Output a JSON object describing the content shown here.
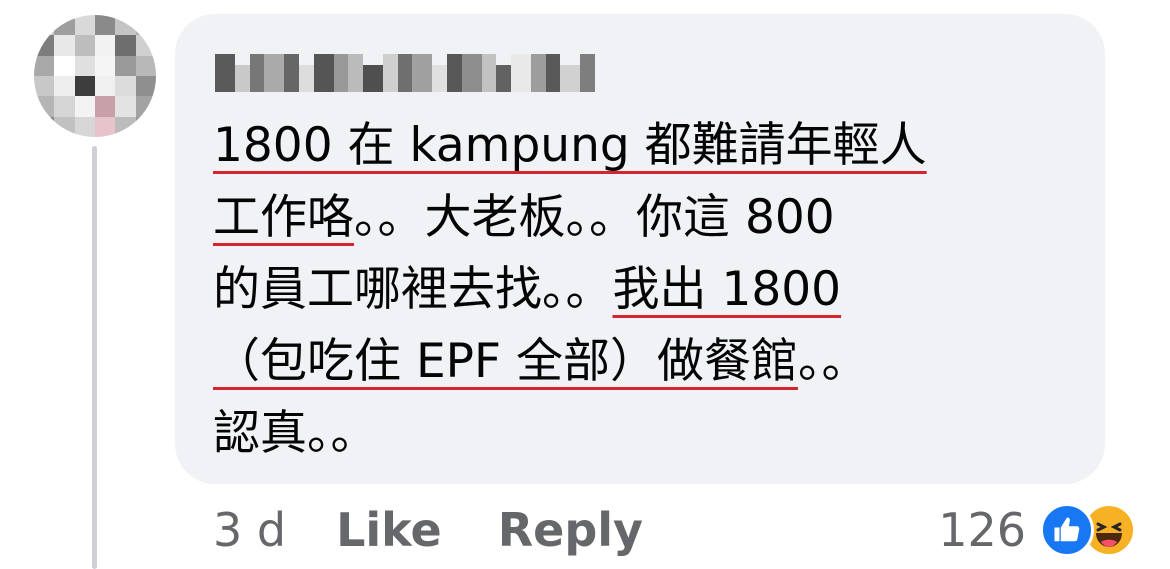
{
  "comment": {
    "author_name": "Lucky Ann Tan",
    "lines": [
      [
        {
          "t": "1800 在 kampung 都難請年輕人",
          "u": true
        }
      ],
      [
        {
          "t": "工作咯",
          "u": true
        },
        {
          "t": "。。大老板。。你這 800",
          "u": false
        }
      ],
      [
        {
          "t": "的員工哪裡去找。。",
          "u": false
        },
        {
          "t": "我出 1800",
          "u": true
        }
      ],
      [
        {
          "t": "（包吃住 EPF 全部）做餐館",
          "u": true
        },
        {
          "t": "。。",
          "u": false
        }
      ],
      [
        {
          "t": "認真。。",
          "u": false
        }
      ]
    ],
    "time": "3 d",
    "like_label": "Like",
    "reply_label": "Reply",
    "reaction_count": "126",
    "reaction_icons": [
      "like-icon",
      "haha-icon"
    ]
  },
  "colors": {
    "bubble_bg": "#f0f2f5",
    "underline": "#d6242e",
    "meta_text": "#65676b",
    "like_blue": "#1877f2",
    "haha_yellow": "#f7b125"
  }
}
